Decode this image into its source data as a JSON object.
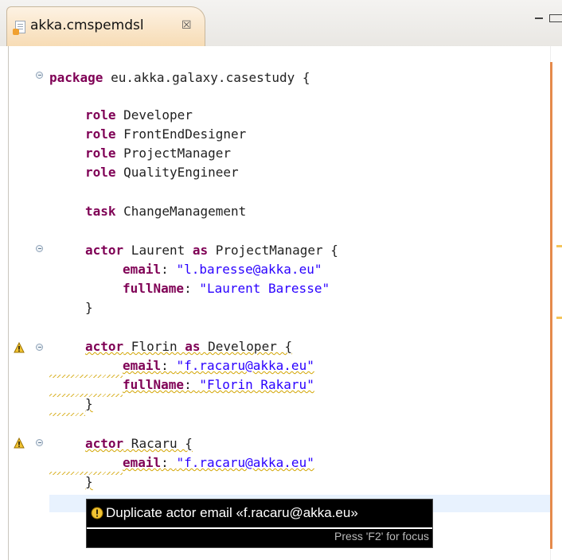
{
  "tab": {
    "title": "akka.cmspemdsl",
    "close_glyph": "☒",
    "icon": "dsl-file-icon"
  },
  "editor": {
    "keyword_color": "#7f0055",
    "string_color": "#2a00ff",
    "warning_color": "#d2a400",
    "lines": {
      "l1": {
        "kw": "package",
        "text": " eu.akka.galaxy.casestudy {"
      },
      "l2": {
        "kw": "role",
        "text": " Developer"
      },
      "l3": {
        "kw": "role",
        "text": " FrontEndDesigner"
      },
      "l4": {
        "kw": "role",
        "text": " ProjectManager"
      },
      "l5": {
        "kw": "role",
        "text": " QualityEngineer"
      },
      "l6": {
        "kw": "task",
        "text": " ChangeManagement"
      },
      "l7": {
        "kw": "actor",
        "name": " Laurent ",
        "kw2": "as",
        "text": " ProjectManager {"
      },
      "l8": {
        "kw": "email",
        "sep": ": ",
        "str": "\"l.baresse@akka.eu\""
      },
      "l9": {
        "kw": "fullName",
        "sep": ": ",
        "str": "\"Laurent Baresse\""
      },
      "l10": {
        "text": "}"
      },
      "l11": {
        "kw": "actor",
        "name": " Florin ",
        "kw2": "as",
        "text": " Developer {"
      },
      "l12": {
        "kw": "email",
        "sep": ": ",
        "str": "\"f.racaru@akka.eu\""
      },
      "l13": {
        "kw": "fullName",
        "sep": ": ",
        "str": "\"Florin Rakaru\""
      },
      "l14": {
        "text": "}"
      },
      "l15": {
        "kw": "actor",
        "text": " Racaru {"
      },
      "l16": {
        "kw": "email",
        "sep": ": ",
        "str": "\"f.racaru@akka.eu\""
      },
      "l17": {
        "text": "}"
      }
    }
  },
  "hover": {
    "message": "Duplicate actor email «f.racaru@akka.eu»",
    "focus_hint": "Press 'F2' for focus",
    "icon": "warning-icon"
  }
}
